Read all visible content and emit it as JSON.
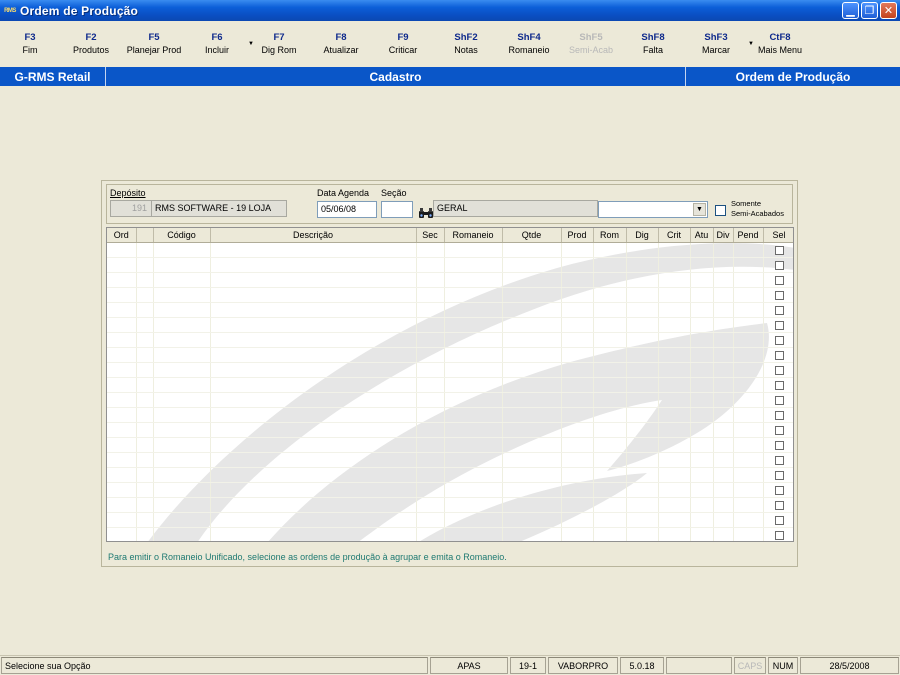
{
  "window": {
    "title": "Ordem de Produção",
    "app_badge": "RMS"
  },
  "toolbar": [
    {
      "key": "F3",
      "label": "Fim",
      "enabled": true
    },
    {
      "key": "F2",
      "label": "Produtos",
      "enabled": true
    },
    {
      "key": "F5",
      "label": "Planejar Prod",
      "enabled": true
    },
    {
      "key": "F6",
      "label": "Incluir",
      "enabled": true
    },
    {
      "key": "F7",
      "label": "Dig Rom",
      "enabled": true
    },
    {
      "key": "F8",
      "label": "Atualizar",
      "enabled": true
    },
    {
      "key": "F9",
      "label": "Criticar",
      "enabled": true
    },
    {
      "key": "ShF2",
      "label": "Notas",
      "enabled": true
    },
    {
      "key": "ShF4",
      "label": "Romaneio",
      "enabled": true
    },
    {
      "key": "ShF5",
      "label": "Semi-Acab",
      "enabled": false
    },
    {
      "key": "ShF8",
      "label": "Falta",
      "enabled": true
    },
    {
      "key": "ShF3",
      "label": "Marcar",
      "enabled": true
    },
    {
      "key": "CtF8",
      "label": "Mais Menu",
      "enabled": true
    }
  ],
  "band": {
    "left": "G-RMS Retail",
    "center": "Cadastro",
    "right": "Ordem de Produção"
  },
  "filters": {
    "deposito_label": "Depósito",
    "deposito_code": "191",
    "deposito_name": "RMS SOFTWARE  - 19 LOJA",
    "data_agenda_label": "Data Agenda",
    "data_agenda_value": "05/06/08",
    "secao_label": "Seção",
    "secao_code": "",
    "secao_name": "GERAL",
    "combo_value": "",
    "somente_label_1": "Somente",
    "somente_label_2": "Semi-Acabados",
    "somente_checked": false
  },
  "grid": {
    "columns": [
      "Ord",
      "",
      "Código",
      "Descrição",
      "Sec",
      "Romaneio",
      "Qtde",
      "Prod",
      "Rom",
      "Dig",
      "Crit",
      "Atu",
      "Div",
      "Pend",
      "Sel"
    ],
    "row_count": 20
  },
  "hint": "Para emitir o Romaneio Unificado, selecione as ordens de produção à agrupar e emita o Romaneio.",
  "statusbar": {
    "message": "Selecione sua Opção",
    "cells": [
      "APAS",
      "19-1",
      "VABORPRO",
      "5.0.18",
      "",
      "CAPS",
      "NUM",
      "28/5/2008"
    ]
  },
  "colors": {
    "titlebar": "#0a4fc4",
    "band": "#0a56c8",
    "hint": "#1f7a72"
  }
}
